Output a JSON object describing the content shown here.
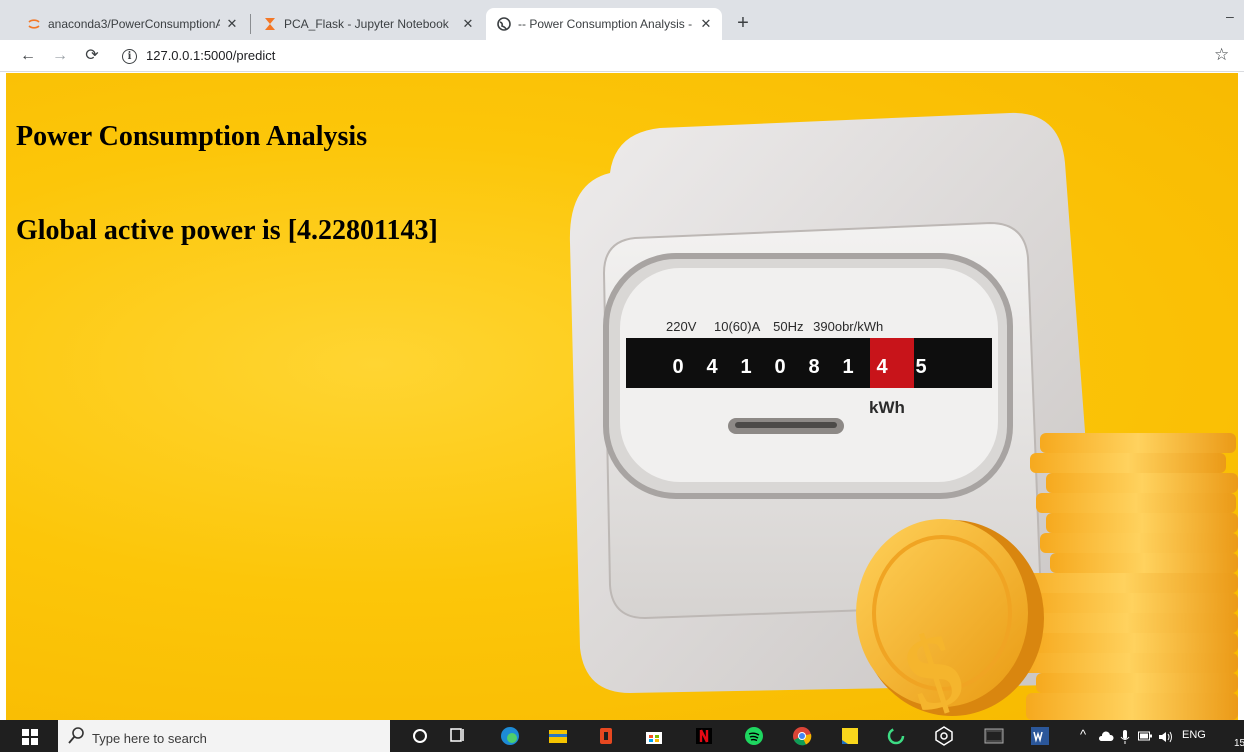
{
  "browser": {
    "tabs": [
      {
        "title": "anaconda3/PowerConsumptionA",
        "favicon": "jupyter-ring-icon"
      },
      {
        "title": "PCA_Flask - Jupyter Notebook",
        "favicon": "hourglass-icon"
      },
      {
        "title": "-- Power Consumption Analysis -",
        "favicon": "globe-icon"
      }
    ],
    "new_tab_label": "+",
    "minimize_label": "–",
    "url": "127.0.0.1:5000/predict"
  },
  "page": {
    "heading": "Power Consumption Analysis",
    "result_prefix": "Global active power is ",
    "result_value": "[4.22801143]"
  },
  "meter": {
    "spec_voltage": "220V",
    "spec_current": "10(60)A",
    "spec_frequency": "50Hz",
    "spec_constant": "390obr/kWh",
    "digits": [
      "0",
      "4",
      "1",
      "0",
      "8",
      "1",
      "4"
    ],
    "red_digit": "5",
    "unit": "kWh",
    "coin_symbol": "$"
  },
  "taskbar": {
    "search_placeholder": "Type here to search",
    "language": "ENG",
    "clock_partial": "15"
  },
  "colors": {
    "page_background": "#fcc609",
    "tabstrip": "#dee1e6",
    "taskbar": "#1f1f1f"
  }
}
